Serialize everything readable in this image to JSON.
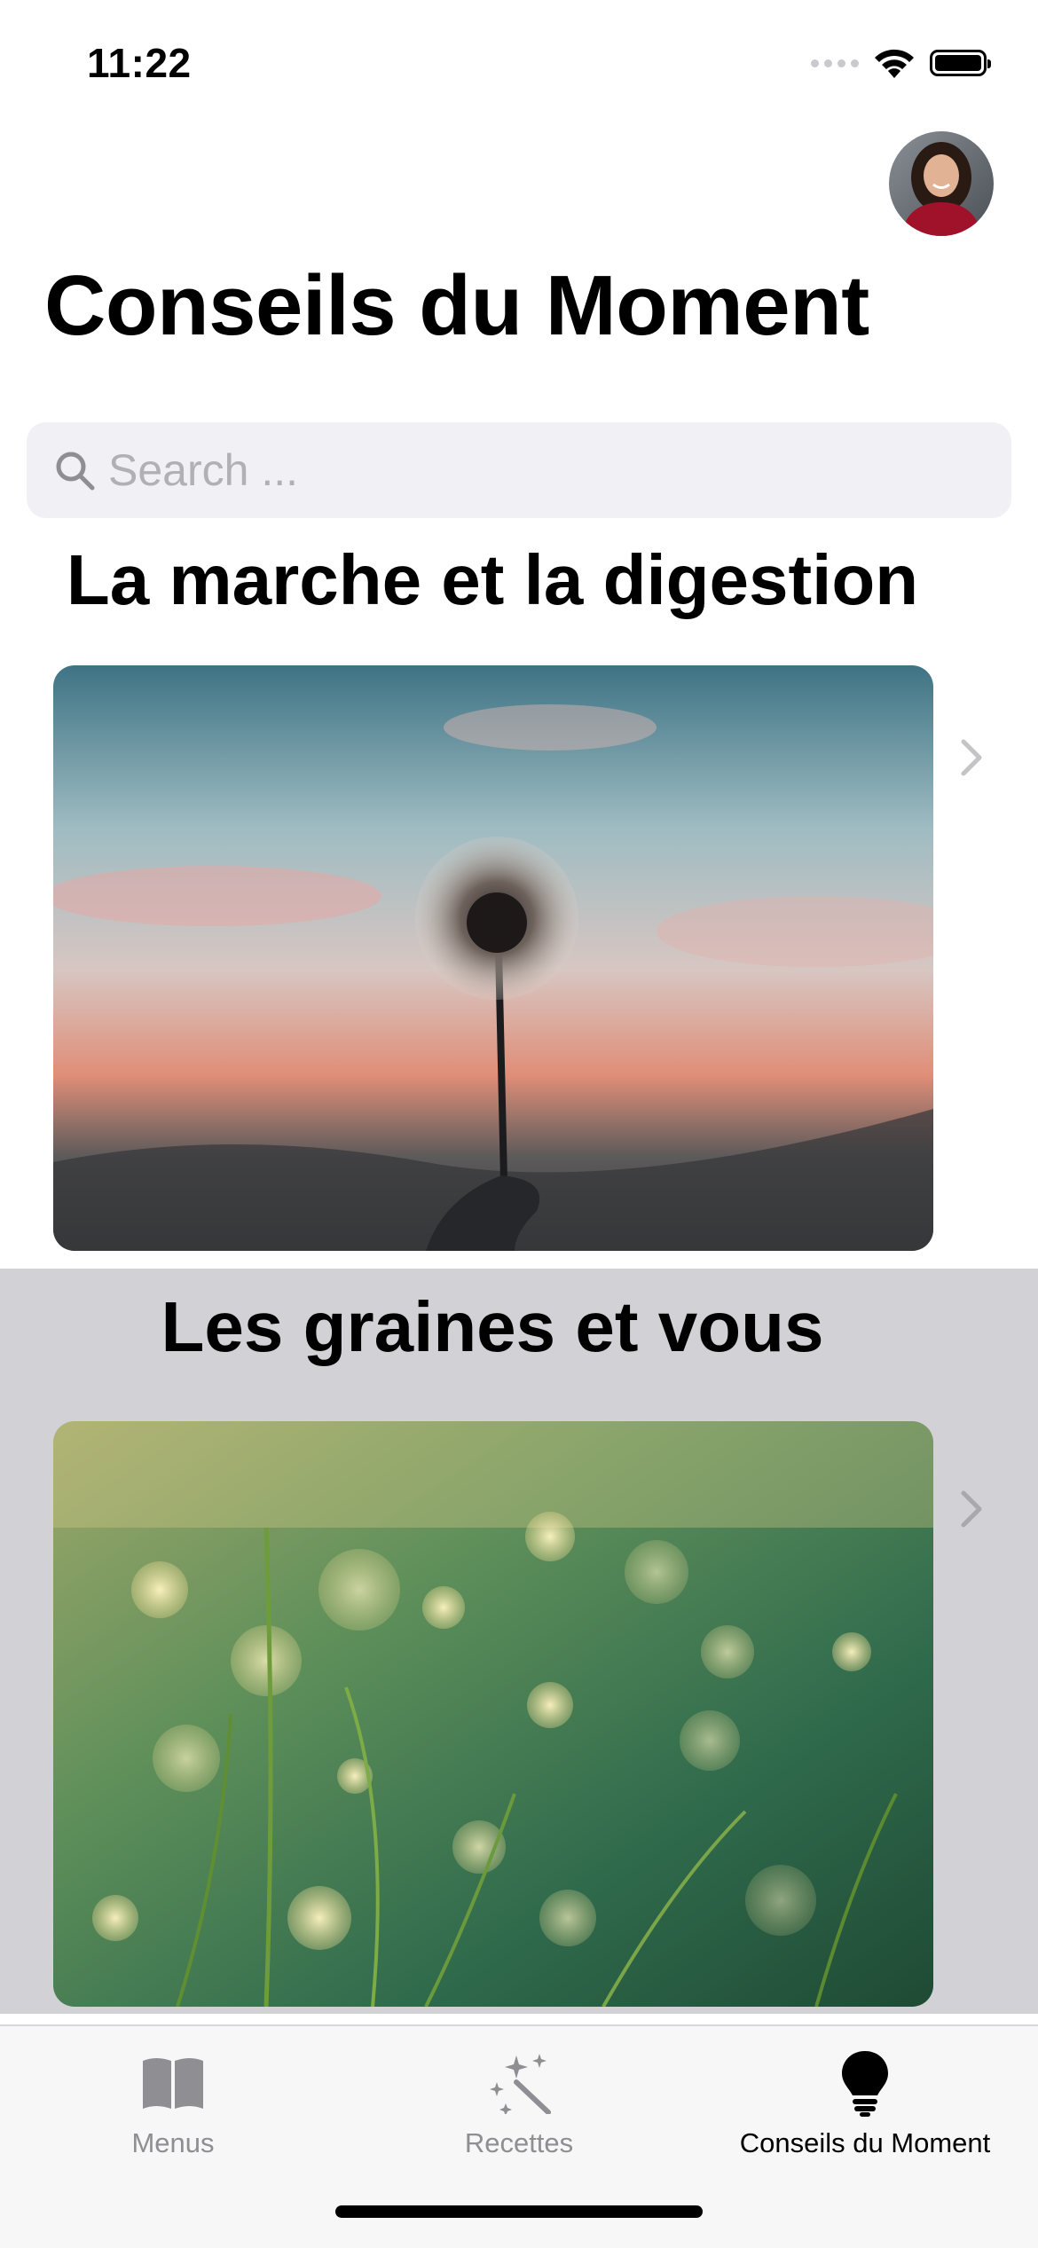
{
  "status_bar": {
    "time": "11:22"
  },
  "header": {
    "title": "Conseils du Moment"
  },
  "search": {
    "placeholder": "Search ..."
  },
  "tips": [
    {
      "title": "La marche et la digestion",
      "image": "dandelion-sunset-photo"
    },
    {
      "title": "Les graines et vous",
      "image": "grass-dew-bokeh-photo"
    }
  ],
  "tab_bar": {
    "items": [
      {
        "label": "Menus",
        "icon": "book-icon",
        "active": false
      },
      {
        "label": "Recettes",
        "icon": "magic-wand-icon",
        "active": false
      },
      {
        "label": "Conseils du Moment",
        "icon": "lightbulb-icon",
        "active": true
      }
    ]
  },
  "colors": {
    "search_bg": "#f0f0f5",
    "selected_row_bg": "#d1d1d6",
    "tab_inactive": "#8e8e93",
    "tab_active": "#000000"
  }
}
